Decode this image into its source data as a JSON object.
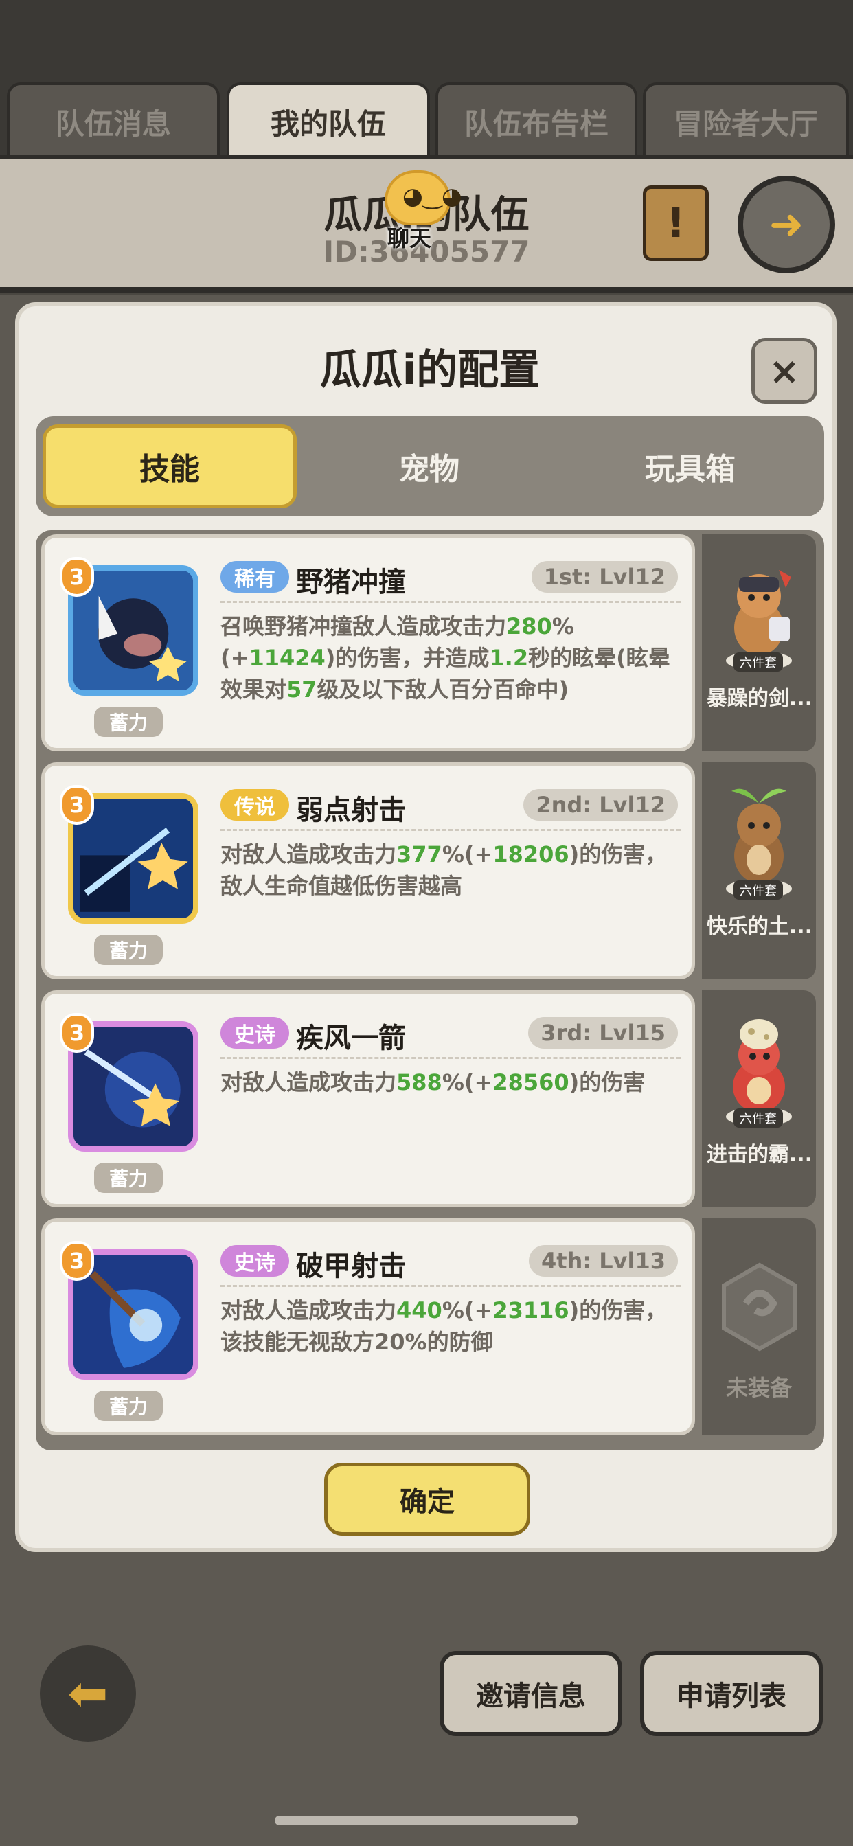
{
  "tabs": [
    "队伍消息",
    "我的队伍",
    "队伍布告栏",
    "冒险者大厅"
  ],
  "team": {
    "name": "瓜瓜i的队伍",
    "id": "ID:36405577"
  },
  "chat": {
    "label": "聊天"
  },
  "modal": {
    "title": "瓜瓜i的配置",
    "close_icon": "×",
    "segments": [
      "技能",
      "宠物",
      "玩具箱"
    ],
    "skills": [
      {
        "level_badge": "3",
        "charge": "蓄力",
        "rarity": "稀有",
        "rarity_color": "#6fa8e8",
        "name": "野猪冲撞",
        "slot": "1st: Lvl12",
        "desc_a": "召唤野猪冲撞敌人造成攻击力",
        "pct": "280",
        "desc_b": "%(+",
        "flat": "11424",
        "desc_c": ")的伤害，并造成",
        "sec": "1.2",
        "desc_d": "秒的眩晕(眩晕效果对",
        "lv": "57",
        "desc_e": "级及以下敌人百分百命中)"
      },
      {
        "level_badge": "3",
        "charge": "蓄力",
        "rarity": "传说",
        "rarity_color": "#efbf3c",
        "name": "弱点射击",
        "slot": "2nd: Lvl12",
        "desc_a": "对敌人造成攻击力",
        "pct": "377",
        "desc_b": "%(+",
        "flat": "18206",
        "desc_c": ")的伤害，敌人生命值越低伤害越高"
      },
      {
        "level_badge": "3",
        "charge": "蓄力",
        "rarity": "史诗",
        "rarity_color": "#cf86da",
        "name": "疾风一箭",
        "slot": "3rd: Lvl15",
        "desc_a": "对敌人造成攻击力",
        "pct": "588",
        "desc_b": "%(+",
        "flat": "28560",
        "desc_c": ")的伤害"
      },
      {
        "level_badge": "3",
        "charge": "蓄力",
        "rarity": "史诗",
        "rarity_color": "#cf86da",
        "name": "破甲射击",
        "slot": "4th: Lvl13",
        "desc_a": "对敌人造成攻击力",
        "pct": "440",
        "desc_b": "%(+",
        "flat": "23116",
        "desc_c": ")的伤害，该技能无视敌方20%的防御"
      }
    ],
    "pets": [
      {
        "tag": "六件套",
        "name": "暴躁的剑...",
        "icon": "armored-tanuki-icon"
      },
      {
        "tag": "六件套",
        "name": "快乐的土...",
        "icon": "sprout-tanuki-icon"
      },
      {
        "tag": "六件套",
        "name": "进击的霸...",
        "icon": "red-dino-icon"
      },
      {
        "empty": "未装备",
        "icon": "empty-slot-icon"
      }
    ],
    "confirm": "确定"
  },
  "bottom": {
    "invite": "邀请信息",
    "apply": "申请列表"
  },
  "colors": {
    "accent_yellow": "#f4df72",
    "bonus_green": "#4ba63a"
  }
}
